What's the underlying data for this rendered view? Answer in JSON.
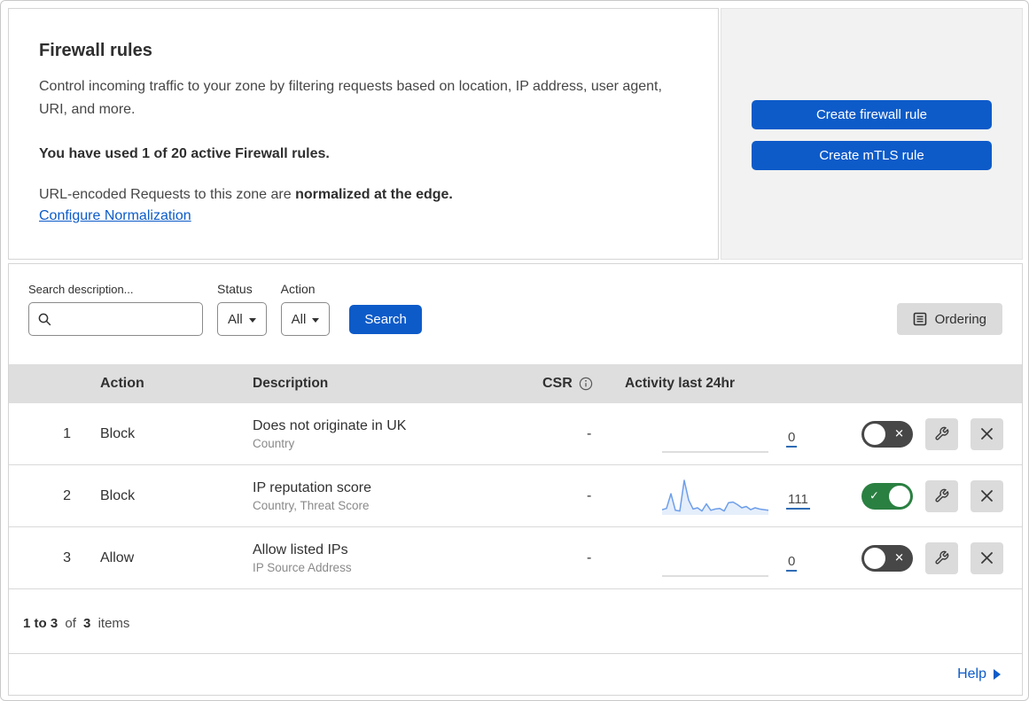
{
  "colors": {
    "accent_blue": "#0d5bc9",
    "toggle_on_green": "#2a8041",
    "toggle_off_gray": "#474747",
    "sparkline_blue": "#6d9eea",
    "table_header_gray": "#dedede",
    "panel_gray": "#f2f2f2"
  },
  "header": {
    "title": "Firewall rules",
    "description": "Control incoming traffic to your zone by filtering requests based on location, IP address, user agent, URI, and more.",
    "usage_bold": "You have used 1 of 20 active Firewall rules.",
    "normalization_prefix": "URL-encoded Requests to this zone are ",
    "normalization_bold": "normalized at the edge.",
    "normalization_link": "Configure Normalization"
  },
  "actions_panel": {
    "create_firewall_label": "Create firewall rule",
    "create_mtls_label": "Create mTLS rule"
  },
  "filters": {
    "search_label": "Search description...",
    "status_label": "Status",
    "status_value": "All",
    "action_label": "Action",
    "action_value": "All",
    "search_button": "Search",
    "ordering_button": "Ordering"
  },
  "table": {
    "columns": {
      "action": "Action",
      "description": "Description",
      "csr": "CSR",
      "activity": "Activity last 24hr"
    },
    "rows": [
      {
        "index": "1",
        "action": "Block",
        "description": "Does not originate in UK",
        "match_fields": "Country",
        "csr": "-",
        "activity_count": "0",
        "enabled": false,
        "sparkline": null
      },
      {
        "index": "2",
        "action": "Block",
        "description": "IP reputation score",
        "match_fields": "Country, Threat Score",
        "csr": "-",
        "activity_count": "111",
        "enabled": true,
        "sparkline": [
          8,
          12,
          58,
          6,
          4,
          100,
          38,
          10,
          14,
          4,
          26,
          6,
          10,
          12,
          4,
          30,
          32,
          24,
          14,
          18,
          8,
          14,
          10,
          8,
          6
        ]
      },
      {
        "index": "3",
        "action": "Allow",
        "description": "Allow listed IPs",
        "match_fields": "IP Source Address",
        "csr": "-",
        "activity_count": "0",
        "enabled": false,
        "sparkline": null
      }
    ],
    "summary": {
      "range": "1 to 3",
      "of_word": "of",
      "total": "3",
      "items_word": "items"
    }
  },
  "help": {
    "label": "Help"
  },
  "chart_data": {
    "type": "area",
    "title": "Activity last 24hr sparkline (rule 2: IP reputation score)",
    "x": "last 24 hours, evenly spaced samples",
    "values": [
      8,
      12,
      58,
      6,
      4,
      100,
      38,
      10,
      14,
      4,
      26,
      6,
      10,
      12,
      4,
      30,
      32,
      24,
      14,
      18,
      8,
      14,
      10,
      8,
      6
    ],
    "ylim": [
      0,
      100
    ],
    "total_events_label": "111"
  }
}
